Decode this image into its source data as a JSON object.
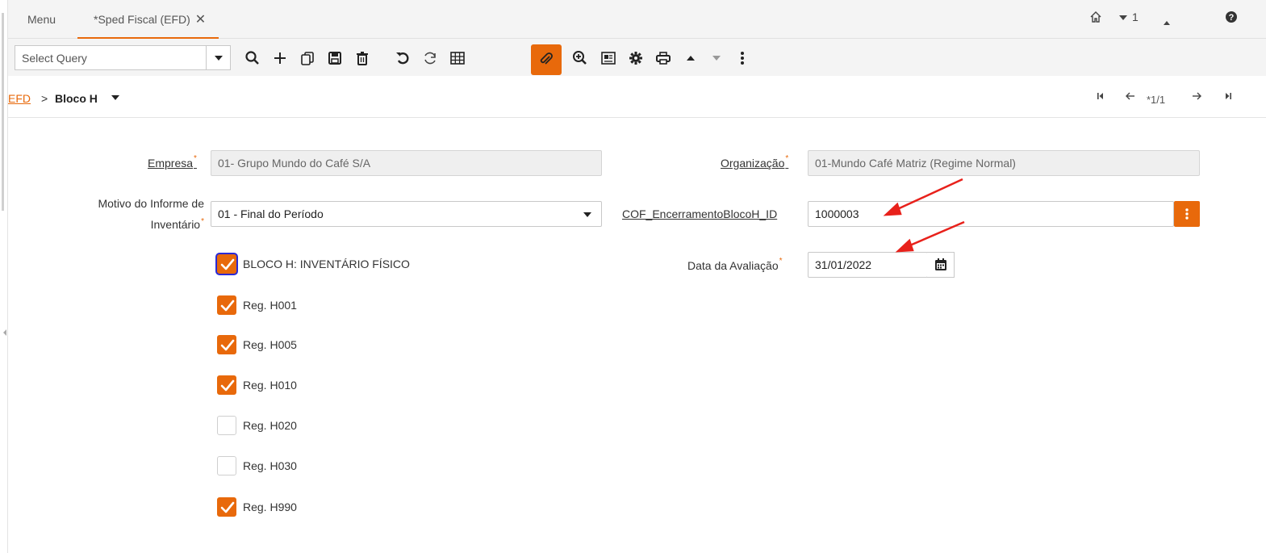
{
  "tabs": {
    "menu_label": "Menu",
    "active_label": "*Sped Fiscal (EFD)"
  },
  "header_right": {
    "count": "1"
  },
  "toolbar": {
    "query_placeholder": "Select Query"
  },
  "breadcrumb": {
    "parent": "EFD",
    "separator": ">",
    "current": "Bloco H"
  },
  "record_nav": {
    "position": "*1/1"
  },
  "form": {
    "empresa": {
      "label": "Empresa",
      "value": "01- Grupo Mundo do Café S/A"
    },
    "organizacao": {
      "label": "Organização",
      "value": "01-Mundo Café Matriz (Regime Normal)"
    },
    "motivo": {
      "label_line1": "Motivo do Informe de",
      "label_line2": "Inventário",
      "value": "01 - Final do Período"
    },
    "cof_id": {
      "label": "COF_EncerramentoBlocoH_ID",
      "value": "1000003"
    },
    "data_avaliacao": {
      "label": "Data da Avaliação",
      "value": "31/01/2022"
    },
    "checkboxes": [
      {
        "label": "BLOCO H: INVENTÁRIO FÍSICO",
        "checked": true
      },
      {
        "label": "Reg. H001",
        "checked": true
      },
      {
        "label": "Reg. H005",
        "checked": true
      },
      {
        "label": "Reg. H010",
        "checked": true
      },
      {
        "label": "Reg. H020",
        "checked": false
      },
      {
        "label": "Reg. H030",
        "checked": false
      },
      {
        "label": "Reg. H990",
        "checked": true
      }
    ]
  },
  "colors": {
    "accent": "#e8690b",
    "annotation_arrow": "#e8211b",
    "focus": "#2a2ad6"
  }
}
